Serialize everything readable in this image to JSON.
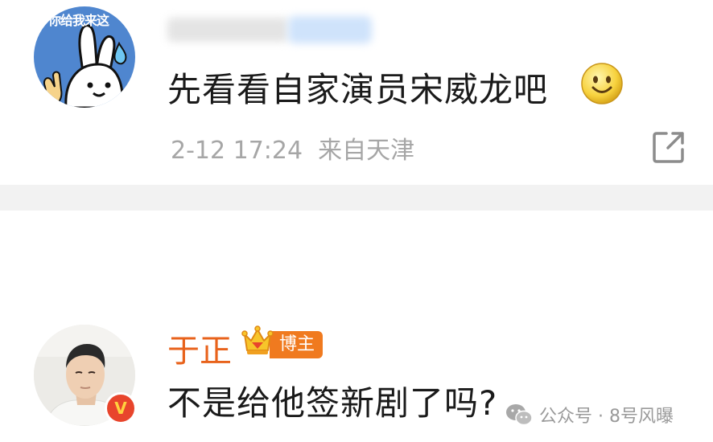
{
  "comment1": {
    "avatar_caption": "你给我来这",
    "text": "先看看自家演员宋威龙吧",
    "emoji": "smile-emoji",
    "date": "2-12 17:24",
    "location": "来自天津",
    "share_icon": "share-icon"
  },
  "comment2": {
    "username": "于正",
    "role_badge": "博主",
    "verified_badge": "V",
    "text": "不是给他签新剧了吗?"
  },
  "watermark": {
    "text": "公众号 · 8号风曝",
    "icon": "wechat-icon"
  },
  "colors": {
    "username": "#e8621b",
    "badge": "#f07a1f",
    "meta": "#a6a6a6",
    "text": "#1a1a1a",
    "divider": "#f2f2f2",
    "avatar1_bg": "#4f86cf",
    "verified": "#e8452c"
  }
}
